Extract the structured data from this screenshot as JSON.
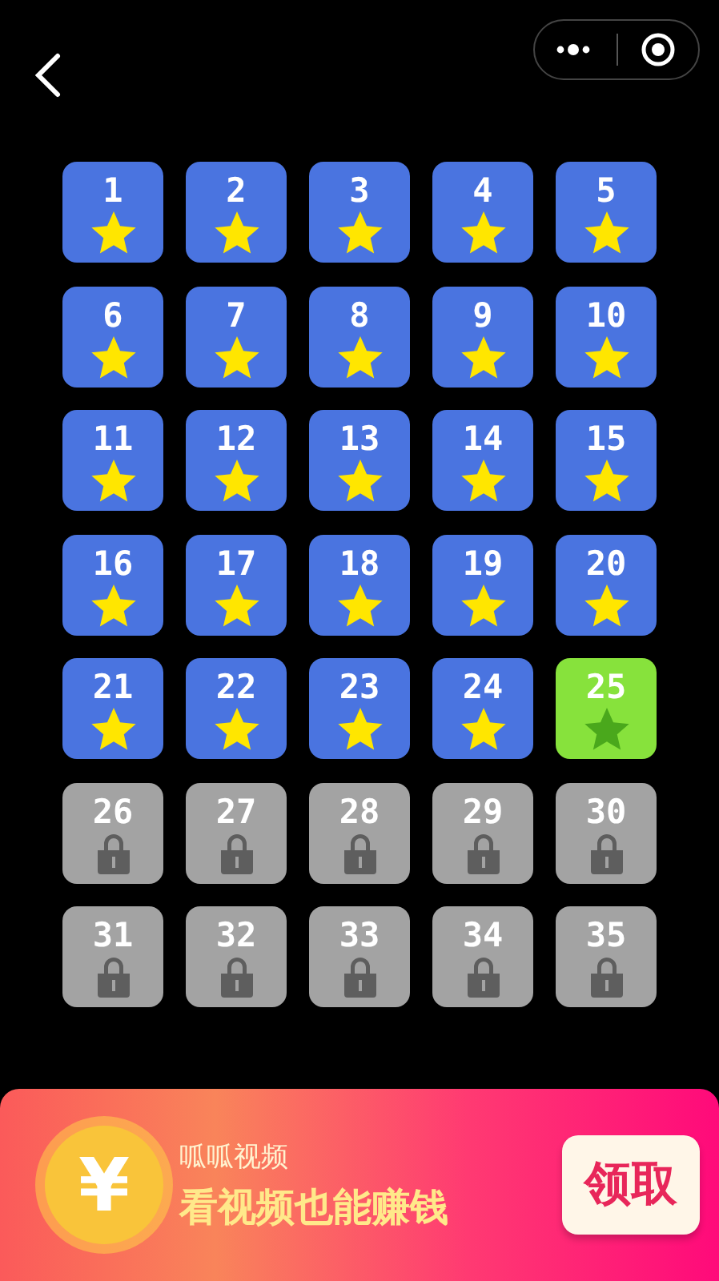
{
  "levels": [
    {
      "label": "1",
      "kind": "done"
    },
    {
      "label": "2",
      "kind": "done"
    },
    {
      "label": "3",
      "kind": "done"
    },
    {
      "label": "4",
      "kind": "done"
    },
    {
      "label": "5",
      "kind": "done"
    },
    {
      "label": "6",
      "kind": "done"
    },
    {
      "label": "7",
      "kind": "done"
    },
    {
      "label": "8",
      "kind": "done"
    },
    {
      "label": "9",
      "kind": "done"
    },
    {
      "label": "10",
      "kind": "done"
    },
    {
      "label": "11",
      "kind": "done"
    },
    {
      "label": "12",
      "kind": "done"
    },
    {
      "label": "13",
      "kind": "done"
    },
    {
      "label": "14",
      "kind": "done"
    },
    {
      "label": "15",
      "kind": "done"
    },
    {
      "label": "16",
      "kind": "done"
    },
    {
      "label": "17",
      "kind": "done"
    },
    {
      "label": "18",
      "kind": "done"
    },
    {
      "label": "19",
      "kind": "done"
    },
    {
      "label": "20",
      "kind": "done"
    },
    {
      "label": "21",
      "kind": "done"
    },
    {
      "label": "22",
      "kind": "done"
    },
    {
      "label": "23",
      "kind": "done"
    },
    {
      "label": "24",
      "kind": "done"
    },
    {
      "label": "25",
      "kind": "current"
    },
    {
      "label": "26",
      "kind": "locked"
    },
    {
      "label": "27",
      "kind": "locked"
    },
    {
      "label": "28",
      "kind": "locked"
    },
    {
      "label": "29",
      "kind": "locked"
    },
    {
      "label": "30",
      "kind": "locked"
    },
    {
      "label": "31",
      "kind": "locked"
    },
    {
      "label": "32",
      "kind": "locked"
    },
    {
      "label": "33",
      "kind": "locked"
    },
    {
      "label": "34",
      "kind": "locked"
    },
    {
      "label": "35",
      "kind": "locked"
    }
  ],
  "banner": {
    "coin_symbol": "¥",
    "app_name": "呱呱视频",
    "slogan": "看视频也能赚钱",
    "button": "领取"
  }
}
